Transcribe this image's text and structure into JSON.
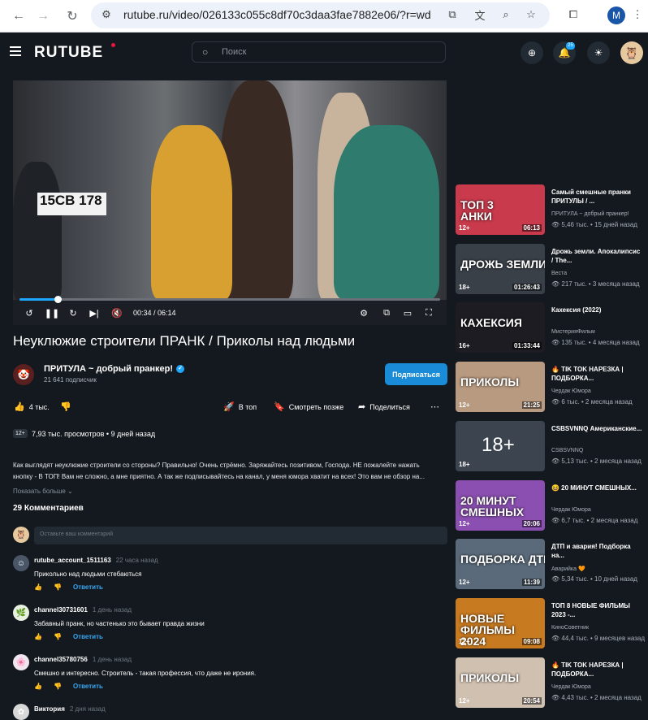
{
  "browser": {
    "url": "rutube.ru/video/026133c055c8df70c3daa3fae7882e06/?r=wd",
    "profile_initial": "M"
  },
  "header": {
    "logo": "RUTUBE",
    "search_placeholder": "Поиск",
    "notifications_count": "25"
  },
  "player": {
    "time": "00:34 / 06:14",
    "progress": 0.091
  },
  "video": {
    "title": "Неуклюжие строители ПРАНК / Приколы над людьми",
    "channel_name": "ПРИТУЛА ~ добрый пранкер!",
    "subscribers": "21 641 подписчик",
    "subscribe_label": "Подписаться",
    "likes": "4 тыс.",
    "actions": {
      "top": "В топ",
      "watch_later": "Смотреть позже",
      "share": "Поделиться"
    },
    "age": "12+",
    "stats": "7,93 тыс. просмотров  •  9 дней назад",
    "description_lines": [
      "Как выглядят неуклюжие строители со стороны? Правильно! Очень стрёмно. Заряжайтесь позитивом, Господа. НЕ пожалейте нажать",
      "кнопку - В ТОП! Вам не сложно, а мне приятно. А так же подписывайтесь на канал, у меня юмора хватит на всех! Это вам не обзор на..."
    ],
    "show_more": "Показать больше"
  },
  "comments": {
    "count_label": "29 Комментариев",
    "input_placeholder": "Оставьте ваш комментарий",
    "reply_label": "Ответить",
    "items": [
      {
        "author": "rutube_account_1511163",
        "time": "22 часа назад",
        "text": "Прикольно над людьми стебаються",
        "avatar_color": "#4a5568"
      },
      {
        "author": "channel30731601",
        "time": "1 день назад",
        "text": "Забавный пранк,  но частенько это бывает правда жизни",
        "avatar_color": "#e8f0e0"
      },
      {
        "author": "channel35780756",
        "time": "1 день назад",
        "text": "Смешно и интересно. Строитель - такая профессия, что даже не ирония.",
        "avatar_color": "#f0e6f0"
      },
      {
        "author": "Виктория",
        "time": "2 дня назад",
        "text": "",
        "avatar_color": "#d8d8d8"
      }
    ]
  },
  "recommendations": [
    {
      "title": "Самый смешные пранки ПРИТУЛЫ / ...",
      "channel": "ПРИТУЛА ~ добрый пранкер!",
      "stats": "5,46 тыс.  •  15 дней назад",
      "age": "12+",
      "duration": "06:13",
      "overlay": "ТОП 3\nАНКИ",
      "bg": "#c83a4c"
    },
    {
      "title": "Дрожь земли. Апокалипсис / The...",
      "channel": "Веста",
      "stats": "217 тыс.  •  3 месяца назад",
      "age": "18+",
      "duration": "01:26:43",
      "overlay": "ДРОЖЬ ЗЕМЛИ",
      "bg": "#3a4048"
    },
    {
      "title": "Кахексия (2022)",
      "channel": "МистерияФильм",
      "stats": "135 тыс.  •  4 месяца назад",
      "age": "16+",
      "duration": "01:33:44",
      "overlay": "КАХЕКСИЯ",
      "bg": "#1c1c22"
    },
    {
      "title": "🔥 TIK TOK НАРЕЗКА |ПОДБОРКА...",
      "channel": "Чердак Юмора",
      "stats": "6 тыс.  •  2 месяца назад",
      "age": "12+",
      "duration": "21:25",
      "overlay": "ПРИКОЛЫ",
      "bg": "#b89a80"
    },
    {
      "title": "CSBSVNNQ Американские...",
      "channel": "CSBSVNNQ",
      "stats": "5,13 тыс.  •  2 месяца назад",
      "age": "18+",
      "duration": "",
      "overlay": "",
      "bg": "#3c4450"
    },
    {
      "title": "😆 20 МИНУТ СМЕШНЫХ...",
      "channel": "Чердак Юмора",
      "stats": "6,7 тыс.  •  2 месяца назад",
      "age": "12+",
      "duration": "20:06",
      "overlay": "20 МИНУТ\nСМЕШНЫХ",
      "bg": "#8a4fb0"
    },
    {
      "title": "ДТП и авария! Подборка на...",
      "channel": "Аварийка 🧡",
      "stats": "5,34 тыс.  •  10 дней назад",
      "age": "12+",
      "duration": "11:39",
      "overlay": "ПОДБОРКА ДТП",
      "bg": "#5a6a7a"
    },
    {
      "title": "ТОП 8 НОВЫЕ ФИЛЬМЫ 2023 -...",
      "channel": "КиноСоветник",
      "stats": "44,4 тыс.  •  9 месяцев назад",
      "age": "12+",
      "duration": "09:08",
      "overlay": "НОВЫЕ\nФИЛЬМЫ\n2024",
      "bg": "#c87a20"
    },
    {
      "title": "🔥 TIK TOK НАРЕЗКА |ПОДБОРКА...",
      "channel": "Чердак Юмора",
      "stats": "4,43 тыс.  •  2 месяца назад",
      "age": "12+",
      "duration": "20:54",
      "overlay": "ПРИКОЛЫ",
      "bg": "#d0c0b0"
    }
  ]
}
